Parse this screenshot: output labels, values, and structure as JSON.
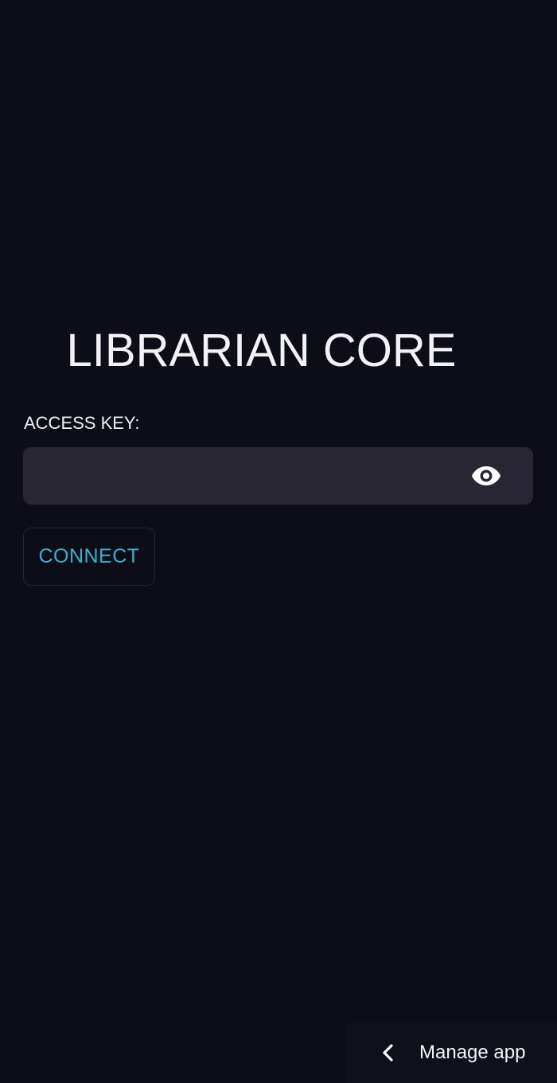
{
  "login": {
    "title": "LIBRARIAN CORE",
    "access_key_label": "ACCESS KEY:",
    "access_key_value": "",
    "access_key_placeholder": "",
    "reveal_icon": "eye-icon",
    "connect_label": "CONNECT"
  },
  "footer": {
    "manage_icon": "chevron-left-icon",
    "manage_label": "Manage app"
  },
  "colors": {
    "background": "#0c0d16",
    "input_background": "#272632",
    "accent": "#33b3cf",
    "text": "#f0f0f3"
  }
}
